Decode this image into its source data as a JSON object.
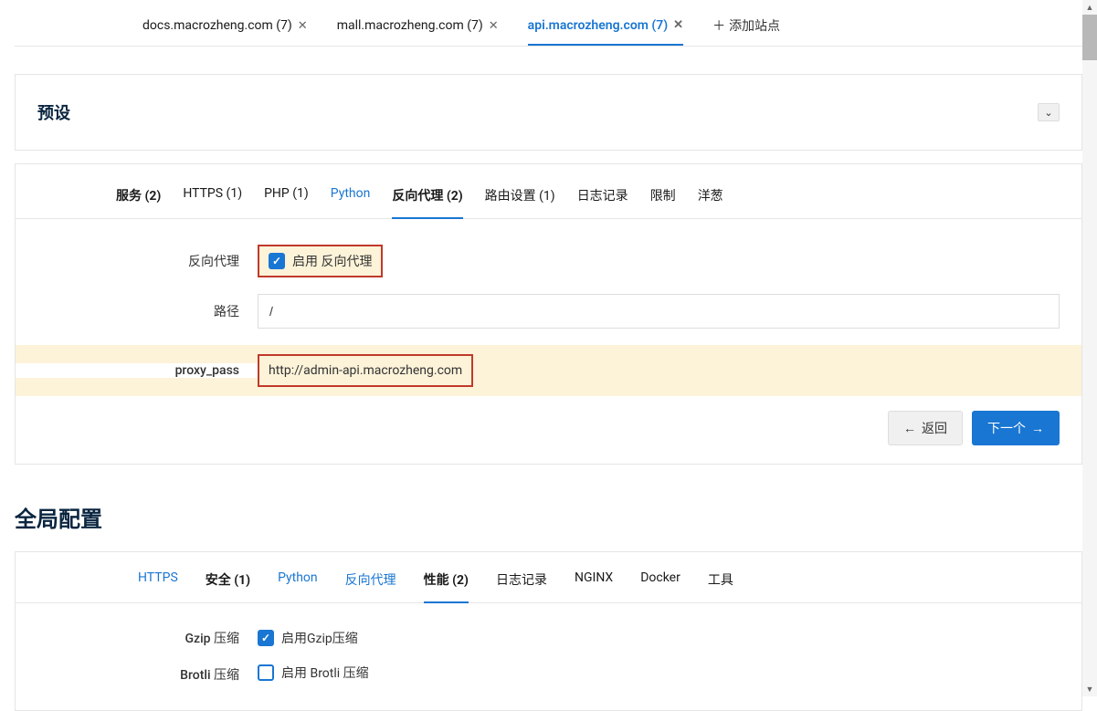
{
  "siteTabs": {
    "items": [
      {
        "label": "docs.macrozheng.com (7)"
      },
      {
        "label": "mall.macrozheng.com (7)"
      },
      {
        "label": "api.macrozheng.com (7)"
      }
    ],
    "addLabel": "添加站点"
  },
  "preset": {
    "title": "预设"
  },
  "configTabs": {
    "items": [
      {
        "label": "服务 (2)"
      },
      {
        "label": "HTTPS (1)"
      },
      {
        "label": "PHP (1)"
      },
      {
        "label": "Python"
      },
      {
        "label": "反向代理 (2)"
      },
      {
        "label": "路由设置 (1)"
      },
      {
        "label": "日志记录"
      },
      {
        "label": "限制"
      },
      {
        "label": "洋葱"
      }
    ]
  },
  "form": {
    "reverseProxyLabel": "反向代理",
    "enableReverseProxy": "启用 反向代理",
    "pathLabel": "路径",
    "pathValue": "/",
    "proxyPassLabel": "proxy_pass",
    "proxyPassValue": "http://admin-api.macrozheng.com"
  },
  "buttons": {
    "back": "返回",
    "next": "下一个"
  },
  "global": {
    "title": "全局配置",
    "tabs": [
      {
        "label": "HTTPS"
      },
      {
        "label": "安全 (1)"
      },
      {
        "label": "Python"
      },
      {
        "label": "反向代理"
      },
      {
        "label": "性能 (2)"
      },
      {
        "label": "日志记录"
      },
      {
        "label": "NGINX"
      },
      {
        "label": "Docker"
      },
      {
        "label": "工具"
      }
    ],
    "gzipLabel": "Gzip 压缩",
    "gzipEnable": "启用Gzip压缩",
    "brotliLabel": "Brotli 压缩",
    "brotliEnable": "启用 Brotli 压缩"
  }
}
